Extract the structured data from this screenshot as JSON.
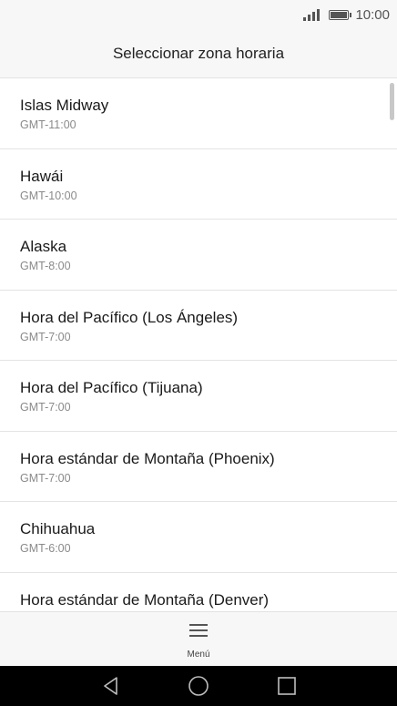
{
  "status_bar": {
    "time": "10:00",
    "signal_icon": "signal-icon",
    "battery_icon": "battery-icon"
  },
  "header": {
    "title": "Seleccionar zona horaria"
  },
  "timezones": [
    {
      "name": "Islas Midway",
      "offset": "GMT-11:00"
    },
    {
      "name": "Hawái",
      "offset": "GMT-10:00"
    },
    {
      "name": "Alaska",
      "offset": "GMT-8:00"
    },
    {
      "name": "Hora del Pacífico (Los Ángeles)",
      "offset": "GMT-7:00"
    },
    {
      "name": "Hora del Pacífico (Tijuana)",
      "offset": "GMT-7:00"
    },
    {
      "name": "Hora estándar de Montaña (Phoenix)",
      "offset": "GMT-7:00"
    },
    {
      "name": "Chihuahua",
      "offset": "GMT-6:00"
    },
    {
      "name": "Hora estándar de Montaña (Denver)",
      "offset": ""
    }
  ],
  "bottom_menu": {
    "label": "Menú",
    "icon": "menu-icon"
  },
  "nav_bar": {
    "back_icon": "back-icon",
    "home_icon": "home-icon",
    "recents_icon": "recents-icon"
  }
}
